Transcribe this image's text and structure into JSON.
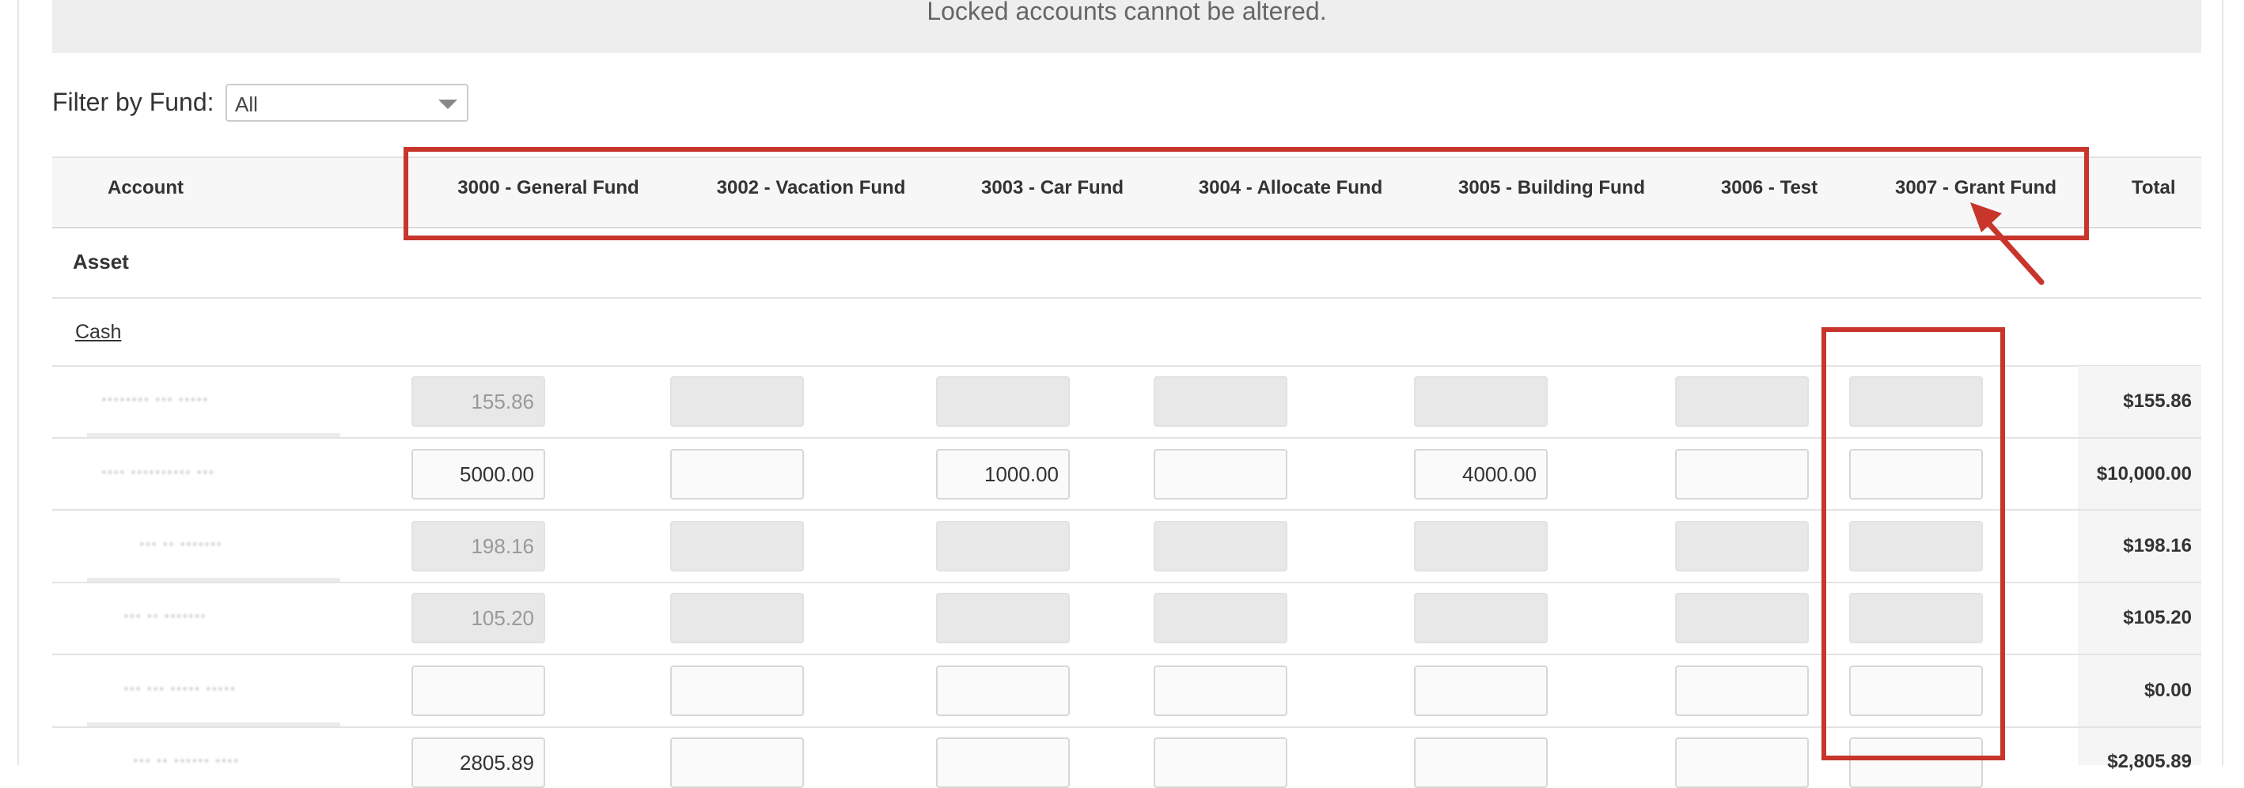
{
  "notice": "Locked accounts cannot be altered.",
  "filter": {
    "label": "Filter by Fund:",
    "value": "All"
  },
  "table": {
    "account_header": "Account",
    "fund_columns": [
      "3000 - General Fund",
      "3002 - Vacation Fund",
      "3003 - Car Fund",
      "3004 - Allocate Fund",
      "3005 - Building Fund",
      "3006 - Test",
      "3007 - Grant Fund"
    ],
    "total_header": "Total",
    "section": "Asset",
    "subsection": "Cash",
    "rows": [
      {
        "label": "········ ··· ·····",
        "locked": true,
        "values": [
          "155.86",
          "",
          "",
          "",
          "",
          "",
          ""
        ],
        "total": "$155.86"
      },
      {
        "label": "···· ·········· ···",
        "locked": false,
        "values": [
          "5000.00",
          "",
          "1000.00",
          "",
          "4000.00",
          "",
          ""
        ],
        "total": "$10,000.00"
      },
      {
        "label": "··· ·· ·······",
        "locked": true,
        "values": [
          "198.16",
          "",
          "",
          "",
          "",
          "",
          ""
        ],
        "total": "$198.16"
      },
      {
        "label": "··· ·· ·······",
        "locked": true,
        "values": [
          "105.20",
          "",
          "",
          "",
          "",
          "",
          ""
        ],
        "total": "$105.20"
      },
      {
        "label": "··· ··· ····· ·····",
        "locked": false,
        "values": [
          "",
          "",
          "",
          "",
          "",
          "",
          ""
        ],
        "total": "$0.00"
      },
      {
        "label": "··· ·· ······ ····",
        "locked": false,
        "values": [
          "2805.89",
          "",
          "",
          "",
          "",
          "",
          ""
        ],
        "total": "$2,805.89"
      }
    ]
  },
  "colors": {
    "annotation": "#c8352a",
    "locked_cell": "#e8e8e8",
    "header_bg": "#f7f7f7"
  }
}
